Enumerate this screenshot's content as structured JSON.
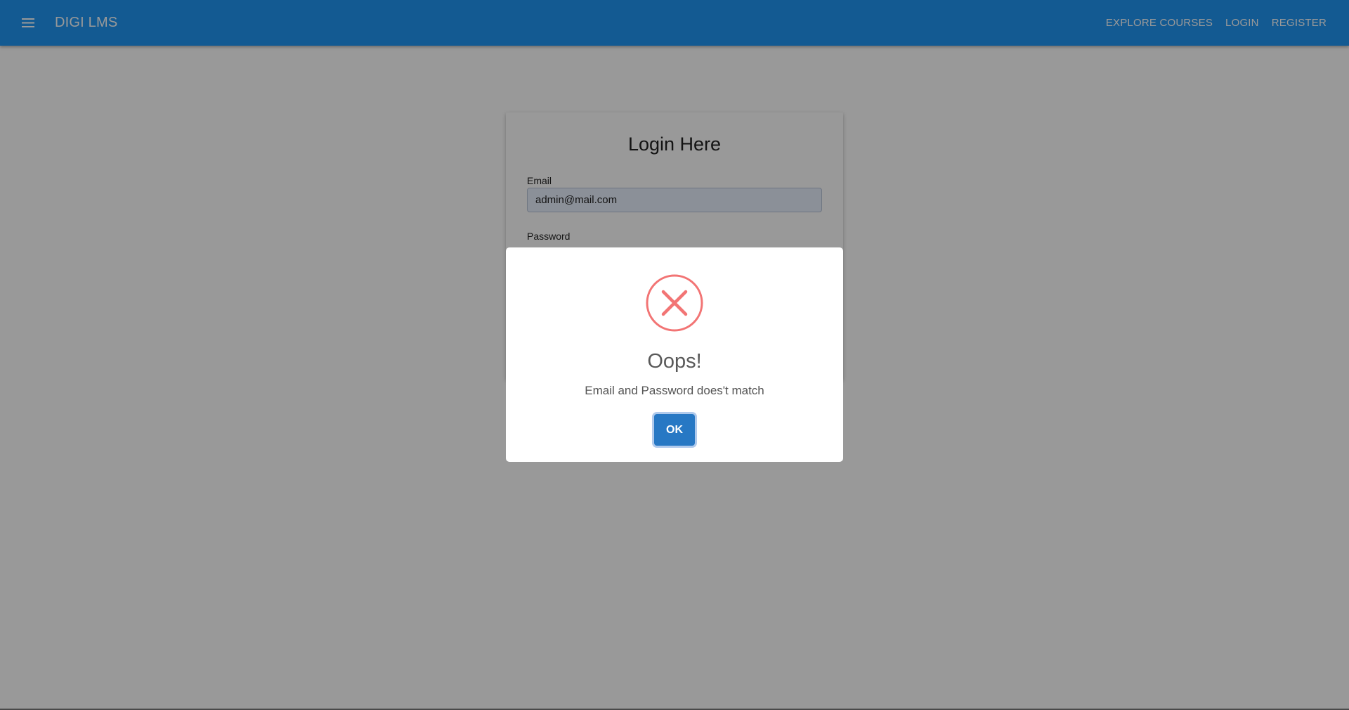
{
  "appbar": {
    "brand": "DIGI LMS",
    "menu_icon": "menu-icon",
    "links": [
      "EXPLORE COURSES",
      "LOGIN",
      "REGISTER"
    ]
  },
  "login": {
    "title": "Login Here",
    "email_label": "Email",
    "email_value": "admin@mail.com",
    "password_label": "Password"
  },
  "modal": {
    "icon": "error-x-icon",
    "title": "Oops!",
    "message": "Email and Password does't match",
    "ok_label": "OK"
  },
  "colors": {
    "appbar": "#2196f3",
    "error": "#f27474",
    "confirm_button": "#2778c4"
  }
}
